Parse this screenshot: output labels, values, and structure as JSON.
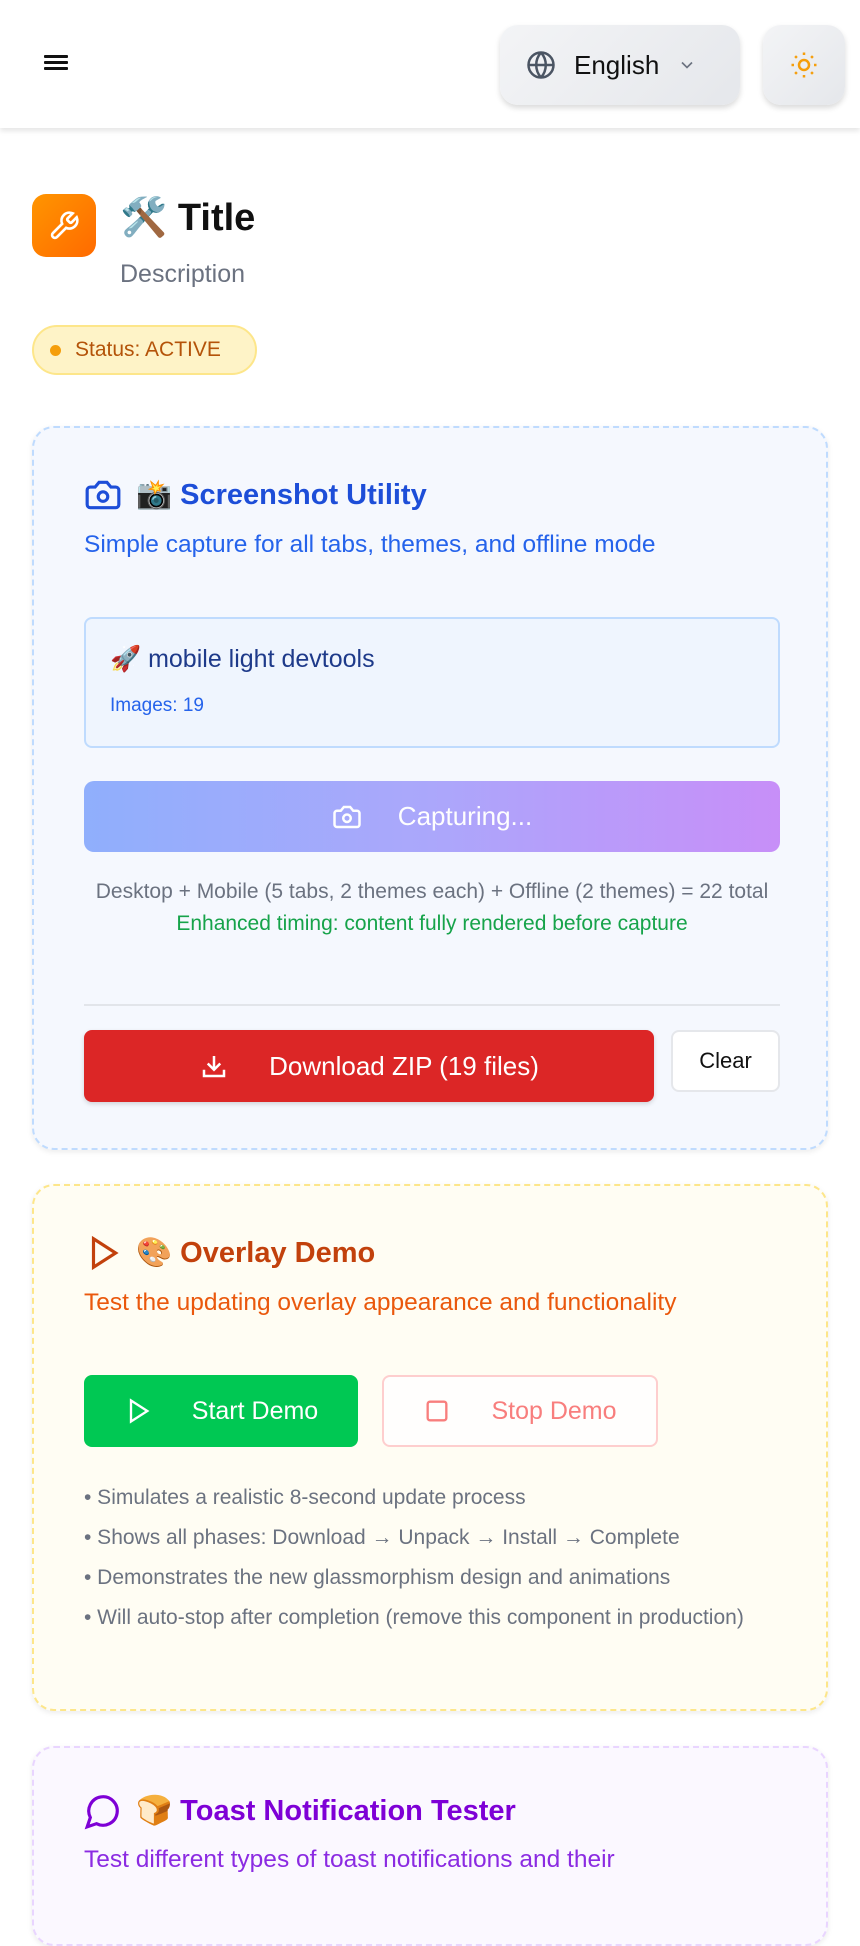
{
  "header": {
    "language": "English",
    "icons": {
      "menu": "hamburger-icon",
      "language": "globe-icon",
      "chevron": "chevron-down-icon",
      "theme": "sun-icon"
    }
  },
  "page": {
    "title": "🛠️ Title",
    "description": "Description",
    "status": "Status: ACTIVE"
  },
  "screenshot": {
    "title": "📸 Screenshot Utility",
    "subtitle": "Simple capture for all tabs, themes, and offline mode",
    "current": "🚀 mobile light devtools",
    "images": "Images: 19",
    "capture_label": "Capturing...",
    "info": "Desktop + Mobile (5 tabs, 2 themes each) + Offline (2 themes) = 22 total",
    "timing": "Enhanced timing: content fully rendered before capture",
    "download_label": "Download ZIP (19 files)",
    "clear_label": "Clear"
  },
  "overlay": {
    "title": "🎨 Overlay Demo",
    "subtitle": "Test the updating overlay appearance and functionality",
    "start_label": "Start Demo",
    "stop_label": "Stop Demo",
    "bullets": [
      "• Simulates a realistic 8-second update process",
      "• Shows all phases: Download → Unpack → Install → Complete",
      "• Demonstrates the new glassmorphism design and animations",
      "• Will auto-stop after completion (remove this component in production)"
    ]
  },
  "toast": {
    "title": "🍞 Toast Notification Tester",
    "subtitle": "Test different types of toast notifications and their"
  },
  "colors": {
    "accent_blue": "#1d4ed8",
    "accent_orange": "#c2410c",
    "accent_purple": "#7e00d6",
    "danger": "#dc2626",
    "success": "#00c853"
  }
}
